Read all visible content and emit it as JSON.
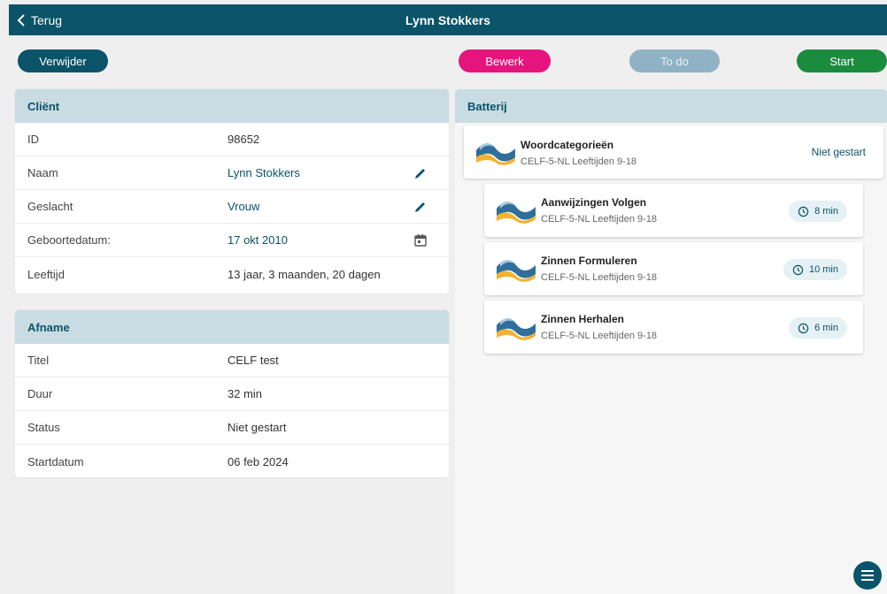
{
  "header": {
    "back_label": "Terug",
    "title": "Lynn Stokkers"
  },
  "actions": {
    "delete_label": "Verwijder",
    "edit_label": "Bewerk",
    "todo_label": "To do",
    "start_label": "Start"
  },
  "client": {
    "title": "Cliënt",
    "rows": [
      {
        "label": "ID",
        "value": "98652"
      },
      {
        "label": "Naam",
        "value": "Lynn Stokkers"
      },
      {
        "label": "Geslacht",
        "value": "Vrouw"
      },
      {
        "label": "Geboortedatum:",
        "value": "17 okt 2010"
      },
      {
        "label": "Leeftijd",
        "value": "13 jaar, 3 maanden, 20 dagen"
      }
    ]
  },
  "afname": {
    "title": "Afname",
    "rows": [
      {
        "label": "Titel",
        "value": "CELF test"
      },
      {
        "label": "Duur",
        "value": "32 min"
      },
      {
        "label": "Status",
        "value": "Niet gestart"
      },
      {
        "label": "Startdatum",
        "value": "06 feb 2024"
      }
    ]
  },
  "battery": {
    "title": "Batterij",
    "main": {
      "name": "Woordcategorieën",
      "subtitle": "CELF-5-NL Leeftijden 9-18",
      "status": "Niet gestart"
    },
    "subtests": [
      {
        "name": "Aanwijzingen Volgen",
        "subtitle": "CELF-5-NL Leeftijden 9-18",
        "duration": "8 min"
      },
      {
        "name": "Zinnen Formuleren",
        "subtitle": "CELF-5-NL Leeftijden 9-18",
        "duration": "10 min"
      },
      {
        "name": "Zinnen Herhalen",
        "subtitle": "CELF-5-NL Leeftijden 9-18",
        "duration": "6 min"
      }
    ]
  },
  "colors": {
    "primary": "#0b5369",
    "edit": "#e5157d",
    "todo": "#8fb3c5",
    "start": "#1b8b3d",
    "header_bg": "#c9dce3"
  },
  "icons": {
    "back": "chevron-left-icon",
    "edit": "pencil-icon",
    "calendar": "calendar-icon",
    "clock": "clock-icon",
    "menu": "menu-icon",
    "logo": "celf-wave-logo"
  }
}
